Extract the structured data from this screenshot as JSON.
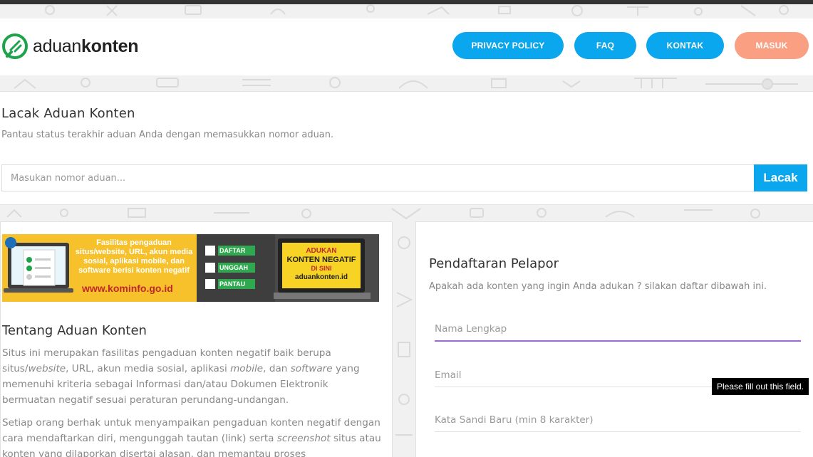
{
  "header": {
    "logo_prefix": "aduan",
    "logo_suffix": "konten",
    "nav": [
      "PRIVACY POLICY",
      "FAQ",
      "KONTAK"
    ],
    "login": "MASUK"
  },
  "track": {
    "title": "Lacak Aduan Konten",
    "subtitle": "Pantau status terakhir aduan Anda dengan memasukkan nomor aduan.",
    "placeholder": "Masukan nomor aduan...",
    "button": "Lacak"
  },
  "banner": {
    "text_lines": [
      "Fasilitas pengaduan",
      "situs/website, URL, akun media",
      "sosial, aplikasi mobile, dan",
      "software berisi konten negatif"
    ],
    "url": "www.kominfo.go.id",
    "steps": [
      "DAFTAR",
      "UNGGAH",
      "PANTAU"
    ],
    "screen_lines": [
      "ADUKAN",
      "KONTEN NEGATIF",
      "DI SINI"
    ],
    "screen_site": "aduankonten.id"
  },
  "about": {
    "title": "Tentang Aduan Konten",
    "p1_a": "Situs ini merupakan fasilitas pengaduan konten negatif baik berupa situs/",
    "p1_b": "website",
    "p1_c": ", URL, akun media sosial, aplikasi ",
    "p1_d": "mobile",
    "p1_e": ", dan ",
    "p1_f": "software",
    "p1_g": " yang memenuhi kriteria sebagai Informasi dan/atau Dokumen Elektronik bermuatan negatif sesuai peraturan perundang-undangan.",
    "p2_a": "Setiap orang berhak untuk menyampaikan pengaduan konten negatif dengan cara mendaftarkan diri, mengunggah tautan (link) serta ",
    "p2_b": "screenshot",
    "p2_c": " situs atau konten yang dilaporkan disertai alasan, dan memantau proses"
  },
  "register": {
    "title": "Pendaftaran Pelapor",
    "subtitle": "Apakah ada konten yang ingin Anda adukan ? silakan daftar dibawah ini.",
    "name_placeholder": "Nama Lengkap",
    "email_placeholder": "Email",
    "password_placeholder": "Kata Sandi Baru (min 8 karakter)"
  },
  "tooltip": "Please fill out this field.",
  "colors": {
    "primary": "#0aa6ee",
    "login": "#fb9f82",
    "focus": "#9b6bd1",
    "banner": "#f6c12a"
  }
}
